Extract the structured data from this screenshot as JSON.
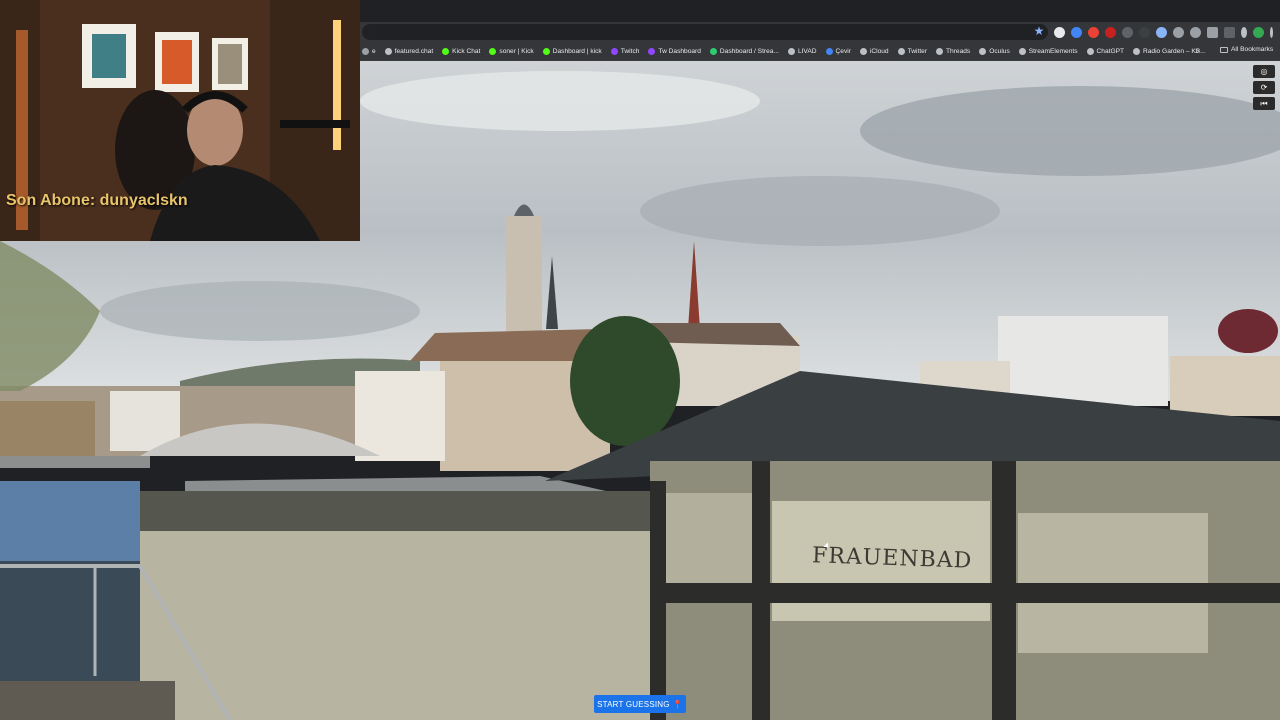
{
  "browser": {
    "bookmarks": [
      {
        "label": "e",
        "color": "#9aa0a6"
      },
      {
        "label": "featured.chat",
        "color": "#bdc1c6"
      },
      {
        "label": "Kick Chat",
        "color": "#53fc18"
      },
      {
        "label": "soner | Kick",
        "color": "#53fc18"
      },
      {
        "label": "Dashboard | kick",
        "color": "#53fc18"
      },
      {
        "label": "Twitch",
        "color": "#9146ff"
      },
      {
        "label": "Tw Dashboard",
        "color": "#9146ff"
      },
      {
        "label": "Dashboard / Strea...",
        "color": "#2ecc71"
      },
      {
        "label": "LIVAD",
        "color": "#bdc1c6"
      },
      {
        "label": "Çevir",
        "color": "#4285f4"
      },
      {
        "label": "iCloud",
        "color": "#bdc1c6"
      },
      {
        "label": "Twitter",
        "color": "#bdc1c6"
      },
      {
        "label": "Threads",
        "color": "#bdc1c6"
      },
      {
        "label": "Oculus",
        "color": "#bdc1c6"
      },
      {
        "label": "StreamElements",
        "color": "#bdc1c6"
      },
      {
        "label": "ChatGPT",
        "color": "#bdc1c6"
      },
      {
        "label": "Radio Garden – KB...",
        "color": "#bdc1c6"
      }
    ],
    "more_label": "»",
    "all_bookmarks_label": "All Bookmarks"
  },
  "overlay": {
    "subscriber_caption": "Son Abone: dunyaclskn"
  },
  "game": {
    "start_button_label": "START GUESSING",
    "sign_text": "FRAUENBAD"
  }
}
